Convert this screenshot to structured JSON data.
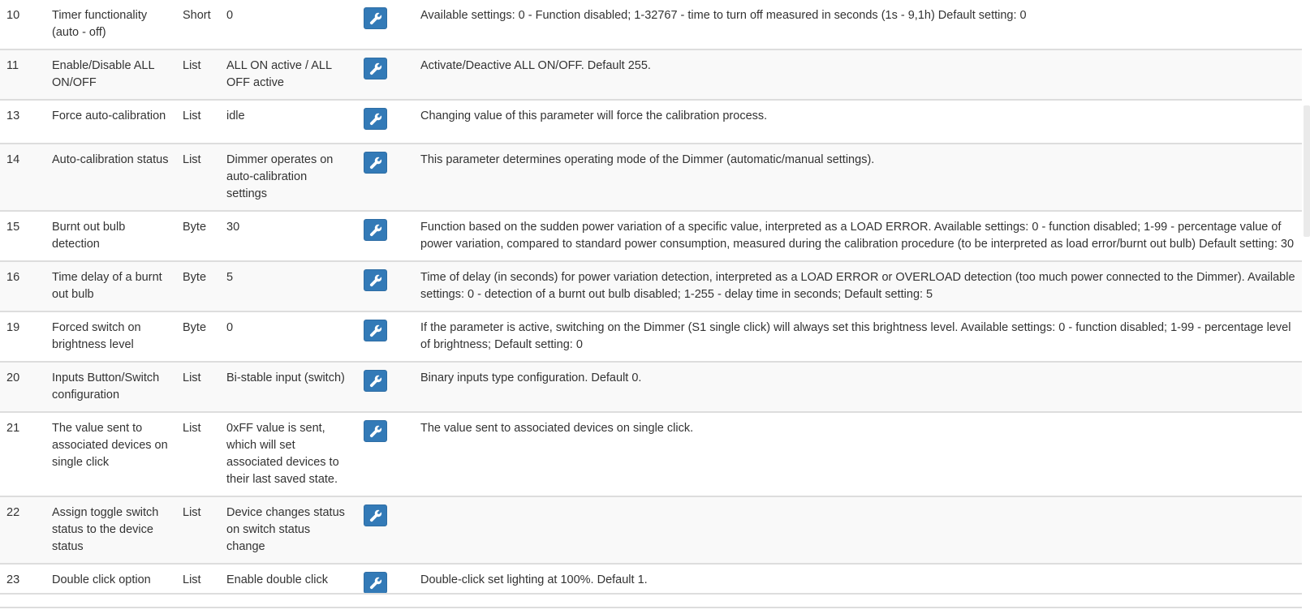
{
  "rows": [
    {
      "number": "10",
      "label": "Timer functionality (auto - off)",
      "type": "Short",
      "value": "0",
      "description": "Available settings: 0 - Function disabled; 1-32767 - time to turn off measured in seconds (1s - 9,1h) Default setting: 0"
    },
    {
      "number": "11",
      "label": "Enable/Disable ALL ON/OFF",
      "type": "List",
      "value": "ALL ON active / ALL OFF active",
      "description": "Activate/Deactive ALL ON/OFF. Default 255."
    },
    {
      "number": "13",
      "label": "Force auto-calibration",
      "type": "List",
      "value": "idle",
      "description": "Changing value of this parameter will force the calibration process."
    },
    {
      "number": "14",
      "label": "Auto-calibration status",
      "type": "List",
      "value": "Dimmer operates on auto-calibration settings",
      "description": "This parameter determines operating mode of the Dimmer (automatic/manual settings)."
    },
    {
      "number": "15",
      "label": "Burnt out bulb detection",
      "type": "Byte",
      "value": "30",
      "description": "Function based on the sudden power variation of a specific value, interpreted as a LOAD ERROR. Available settings: 0 - function disabled; 1-99 - percentage value of power variation, compared to standard power consumption, measured during the calibration procedure (to be interpreted as load error/burnt out bulb) Default setting: 30"
    },
    {
      "number": "16",
      "label": "Time delay of a burnt out bulb",
      "type": "Byte",
      "value": "5",
      "description": "Time of delay (in seconds) for power variation detection, interpreted as a LOAD ERROR or OVERLOAD detection (too much power connected to the Dimmer). Available settings: 0 - detection of a burnt out bulb disabled; 1-255 - delay time in seconds; Default setting: 5"
    },
    {
      "number": "19",
      "label": "Forced switch on brightness level",
      "type": "Byte",
      "value": "0",
      "description": "If the parameter is active, switching on the Dimmer (S1 single click) will always set this brightness level. Available settings: 0 - function disabled; 1-99 - percentage level of brightness; Default setting: 0"
    },
    {
      "number": "20",
      "label": "Inputs Button/Switch configuration",
      "type": "List",
      "value": "Bi-stable input (switch)",
      "description": "Binary inputs type configuration. Default 0."
    },
    {
      "number": "21",
      "label": "The value sent to associated devices on single click",
      "type": "List",
      "value": "0xFF value is sent, which will set associated devices to their last saved state.",
      "description": "The value sent to associated devices on single click."
    },
    {
      "number": "22",
      "label": "Assign toggle switch status to the device status",
      "type": "List",
      "value": "Device changes status on switch status change",
      "description": ""
    },
    {
      "number": "23",
      "label": "Double click option",
      "type": "List",
      "value": "Enable double click",
      "description": "Double-click set lighting at 100%. Default 1."
    }
  ],
  "icons": {
    "edit": "wrench-icon"
  },
  "colors": {
    "button": "#337ab7",
    "row_alt": "#f9f9f9",
    "border": "#dddddd",
    "text": "#333333"
  }
}
